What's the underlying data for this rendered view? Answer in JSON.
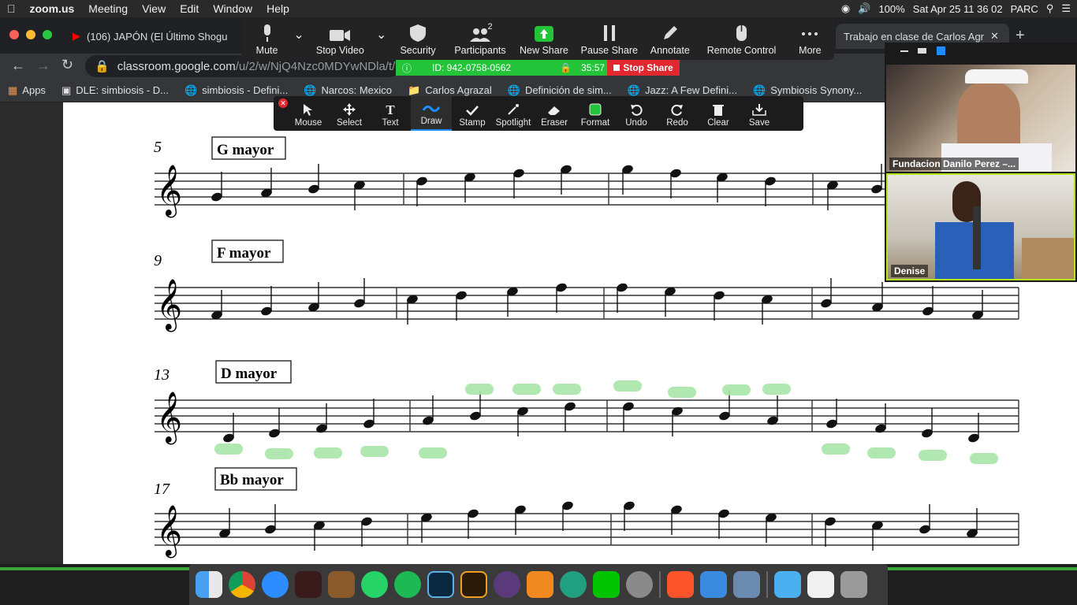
{
  "menubar": {
    "app": "zoom.us",
    "items": [
      "Meeting",
      "View",
      "Edit",
      "Window",
      "Help"
    ],
    "battery": "100%",
    "datetime": "Sat Apr 25  11 36 02",
    "user": "PARC"
  },
  "browser": {
    "tab_left": "(106) JAPÓN (El Último Shogu",
    "tab_right": "Trabajo en clase de Carlos Agr",
    "url_host": "classroom.google.com",
    "url_path": "/u/2/w/NjQ4Nzc0MDYwNDla/t/a",
    "bookmarks": [
      "Apps",
      "DLE: simbiosis - D...",
      "simbiosis - Defini...",
      "Narcos: Mexico",
      "Carlos Agrazal",
      "Definición de sim...",
      "Jazz: A Few Defini...",
      "Symbiosis Synony..."
    ]
  },
  "zoom": {
    "buttons": [
      "Mute",
      "Stop Video",
      "Security",
      "Participants",
      "New Share",
      "Pause Share",
      "Annotate",
      "Remote Control",
      "More"
    ],
    "participants_count": "2",
    "meeting_id": "ID: 942-0758-0562",
    "timer": "35:57",
    "stop_share": "Stop Share"
  },
  "annotate": {
    "tools": [
      "Mouse",
      "Select",
      "Text",
      "Draw",
      "Stamp",
      "Spotlight",
      "Eraser",
      "Format",
      "Undo",
      "Redo",
      "Clear",
      "Save"
    ],
    "selected": "Draw"
  },
  "video": {
    "p1": "Fundacion Danilo Perez –...",
    "p2": "Denise"
  },
  "sheet": {
    "sections": [
      {
        "measure": "5",
        "title": "G mayor"
      },
      {
        "measure": "9",
        "title": "F mayor"
      },
      {
        "measure": "13",
        "title": "D mayor"
      },
      {
        "measure": "17",
        "title": "Bb mayor"
      }
    ]
  },
  "colors": {
    "zoom_green": "#23c33a",
    "stop_red": "#e0282e",
    "highlight": "#a8e6a8"
  }
}
